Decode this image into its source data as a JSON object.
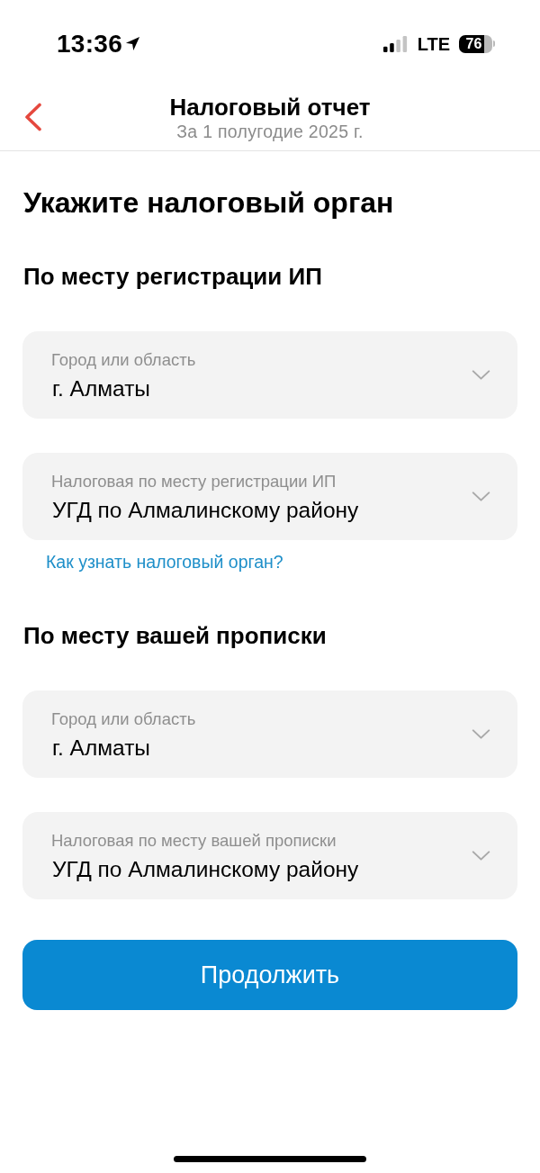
{
  "status_bar": {
    "time": "13:36",
    "network": "LTE",
    "battery": "76"
  },
  "nav": {
    "title": "Налоговый отчет",
    "subtitle": "За 1 полугодие 2025 г."
  },
  "heading": "Укажите налоговый орган",
  "sections": [
    {
      "title": "По месту регистрации ИП",
      "fields": [
        {
          "label": "Город или область",
          "value": "г. Алматы"
        },
        {
          "label": "Налоговая по месту регистрации ИП",
          "value": "УГД по Алмалинскому району"
        }
      ],
      "help_link": "Как узнать налоговый орган?"
    },
    {
      "title": "По месту вашей прописки",
      "fields": [
        {
          "label": "Город или область",
          "value": "г. Алматы"
        },
        {
          "label": "Налоговая по месту вашей прописки",
          "value": "УГД по Алмалинскому району"
        }
      ]
    }
  ],
  "continue_button": "Продолжить"
}
